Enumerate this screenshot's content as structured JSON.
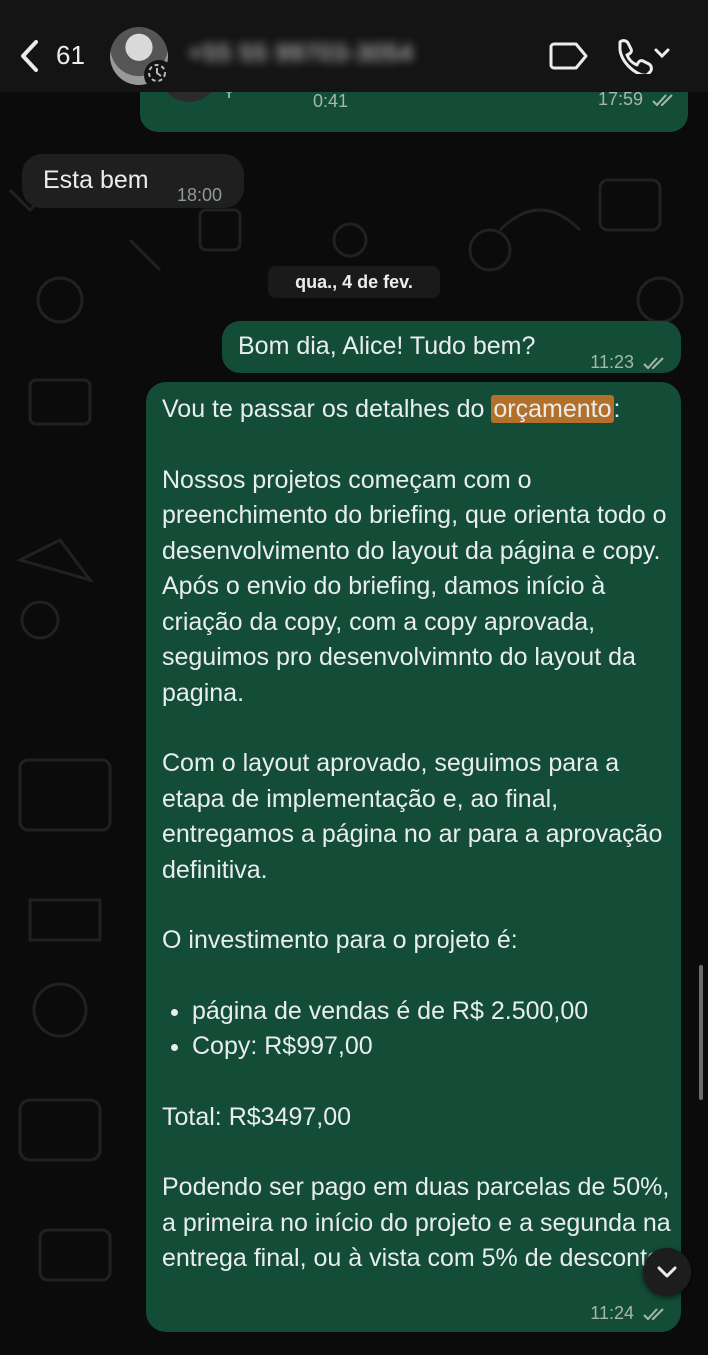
{
  "header": {
    "back_count": "61",
    "contact_name": "+55 55 99703-3054"
  },
  "messages": {
    "voice": {
      "duration": "0:41",
      "time": "17:59"
    },
    "esta_bem": {
      "text": "Esta bem",
      "time": "18:00"
    },
    "date_separator": "qua., 4 de fev.",
    "bom_dia": {
      "text": "Bom dia, Alice! Tudo bem?",
      "time": "11:23"
    },
    "long": {
      "intro_before": "Vou te passar os detalhes do ",
      "intro_highlight": "orçamento",
      "intro_after": ":",
      "para1": "Nossos projetos começam com o preenchimento do briefing, que orienta todo o desenvolvimento do layout da página e copy. Após o envio do briefing, damos início à criação da copy, com a copy aprovada, seguimos pro desenvolvimnto do layout da pagina.",
      "para2": "Com o layout aprovado, seguimos para a etapa de implementação e, ao final, entregamos a página no ar para a aprovação definitiva.",
      "invest": "O investimento para o projeto é:",
      "bullet1": "página de vendas é de R$ 2.500,00",
      "bullet2": "Copy: R$997,00",
      "total": "Total: R$3497,00",
      "para3": "Podendo ser pago em duas parcelas de 50%, a primeira no início do projeto e a segunda na entrega final, ou à vista com 5% de desconto.",
      "time": "11:24"
    }
  },
  "colors": {
    "outgoing_bubble": "#144d37",
    "incoming_bubble": "#1f1f1f",
    "highlight": "#b3702a"
  }
}
